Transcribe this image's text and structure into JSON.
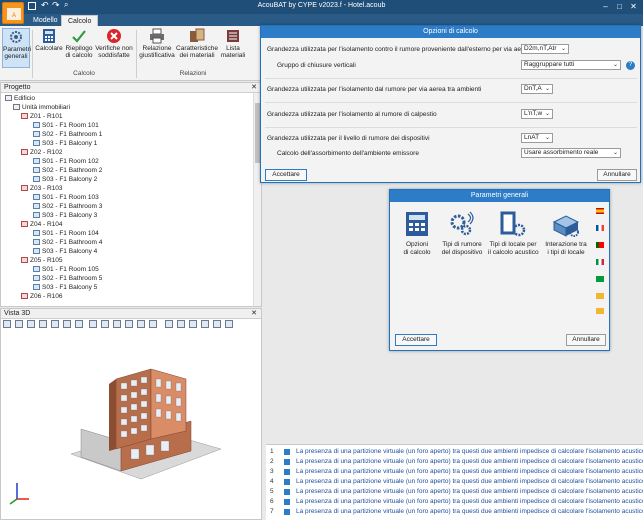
{
  "window": {
    "title": "AcouBAT by CYPE v2023.f - Hotel.acoub"
  },
  "tabs": [
    {
      "label": "Modello"
    },
    {
      "label": "Calcolo"
    }
  ],
  "ribbon": {
    "buttons": [
      {
        "label": "Parametri\ngenerali",
        "icon": "gear-icon"
      },
      {
        "label": "Calcolare",
        "icon": "calculator-icon"
      },
      {
        "label": "Riepilogo\ndi calcolo",
        "icon": "check-pencil-icon"
      },
      {
        "label": "Verifiche non\nsoddisfatte",
        "icon": "error-x-icon"
      },
      {
        "label": "Relazione\ngiustificativa",
        "icon": "printer-icon"
      },
      {
        "label": "Caratteristiche\ndei materiali",
        "icon": "materials-icon"
      },
      {
        "label": "Lista\nmateriali",
        "icon": "list-icon"
      }
    ],
    "groups": [
      {
        "label": "Calcolo"
      },
      {
        "label": "Relazioni"
      }
    ]
  },
  "progetto": {
    "title": "Progetto",
    "root": "Edificio",
    "units": "Unità immobiliari",
    "nodes": [
      {
        "label": "Z01 - R101",
        "type": "zone"
      },
      {
        "label": "S01 - F1 Room 101",
        "type": "room"
      },
      {
        "label": "S02 - F1 Bathroom 1",
        "type": "room"
      },
      {
        "label": "S03 - F1 Balcony 1",
        "type": "room"
      },
      {
        "label": "Z02 - R102",
        "type": "zone"
      },
      {
        "label": "S01 - F1 Room 102",
        "type": "room"
      },
      {
        "label": "S02 - F1 Bathroom 2",
        "type": "room"
      },
      {
        "label": "S03 - F1 Balcony 2",
        "type": "room"
      },
      {
        "label": "Z03 - R103",
        "type": "zone"
      },
      {
        "label": "S01 - F1 Room 103",
        "type": "room"
      },
      {
        "label": "S02 - F1 Bathroom 3",
        "type": "room"
      },
      {
        "label": "S03 - F1 Balcony 3",
        "type": "room"
      },
      {
        "label": "Z04 - R104",
        "type": "zone"
      },
      {
        "label": "S01 - F1 Room 104",
        "type": "room"
      },
      {
        "label": "S02 - F1 Bathroom 4",
        "type": "room"
      },
      {
        "label": "S03 - F1 Balcony 4",
        "type": "room"
      },
      {
        "label": "Z05 - R105",
        "type": "zone"
      },
      {
        "label": "S01 - F1 Room 105",
        "type": "room"
      },
      {
        "label": "S02 - F1 Bathroom 5",
        "type": "room"
      },
      {
        "label": "S03 - F1 Balcony 5",
        "type": "room"
      },
      {
        "label": "Z06 - R106",
        "type": "zone"
      }
    ]
  },
  "vista3d": {
    "title": "Vista 3D"
  },
  "opzioni": {
    "title": "Opzioni di calcolo",
    "rows": [
      {
        "label": "Grandezza utilizzata per l'isolamento contro il rumore proveniente dall'esterno per via aerea",
        "value": "D2m,nT,Atr"
      },
      {
        "label": "Gruppo di chiusure verticali",
        "value": "Raggruppare tutti"
      },
      {
        "label": "Grandezza utilizzata per l'isolamento dal rumore per via aerea tra ambienti",
        "value": "DnT,A"
      },
      {
        "label": "Grandezza utilizzata per l'isolamento al rumore di calpestio",
        "value": "L'nT,w"
      },
      {
        "label": "Grandezza utilizzata per il livello di rumore dei dispositivi",
        "value": "LnAT"
      },
      {
        "label": "Calcolo dell'assorbimento dell'ambiente emissore",
        "value": "Usare assorbimento reale"
      }
    ],
    "accept": "Accettare",
    "cancel": "Annullare"
  },
  "parametri": {
    "title": "Parametri generali",
    "items": [
      {
        "label": "Opzioni\ndi calcolo",
        "icon": "calculator-grid-icon"
      },
      {
        "label": "Tipi di rumore\ndel dispositivo",
        "icon": "gears-sound-icon"
      },
      {
        "label": "Tipi di locale per\nil calcolo acustico",
        "icon": "room-type-icon"
      },
      {
        "label": "Interazione tra\ni tipi di locale",
        "icon": "interaction-icon"
      }
    ],
    "accept": "Accettare",
    "cancel": "Annullare"
  },
  "messages": [
    {
      "num": "1",
      "text": "La presenza di una partizione virtuale (un foro aperto) tra questi due ambienti impedisce di calcolare l'isolamento acustico tra"
    },
    {
      "num": "2",
      "text": "La presenza di una partizione virtuale (un foro aperto) tra questi due ambienti impedisce di calcolare l'isolamento acustico tra"
    },
    {
      "num": "3",
      "text": "La presenza di una partizione virtuale (un foro aperto) tra questi due ambienti impedisce di calcolare l'isolamento acustico tra"
    },
    {
      "num": "4",
      "text": "La presenza di una partizione virtuale (un foro aperto) tra questi due ambienti impedisce di calcolare l'isolamento acustico tra"
    },
    {
      "num": "5",
      "text": "La presenza di una partizione virtuale (un foro aperto) tra questi due ambienti impedisce di calcolare l'isolamento acustico tra"
    },
    {
      "num": "6",
      "text": "La presenza di una partizione virtuale (un foro aperto) tra questi due ambienti impedisce di calcolare l'isolamento acustico tra"
    },
    {
      "num": "7",
      "text": "La presenza di una partizione virtuale (un foro aperto) tra questi due ambienti impedisce di calcolare l'isolamento acustico tra"
    }
  ],
  "colors": {
    "accent": "#2d7cc7",
    "titlebar": "#1f4e79",
    "brand": "#f7941d"
  }
}
